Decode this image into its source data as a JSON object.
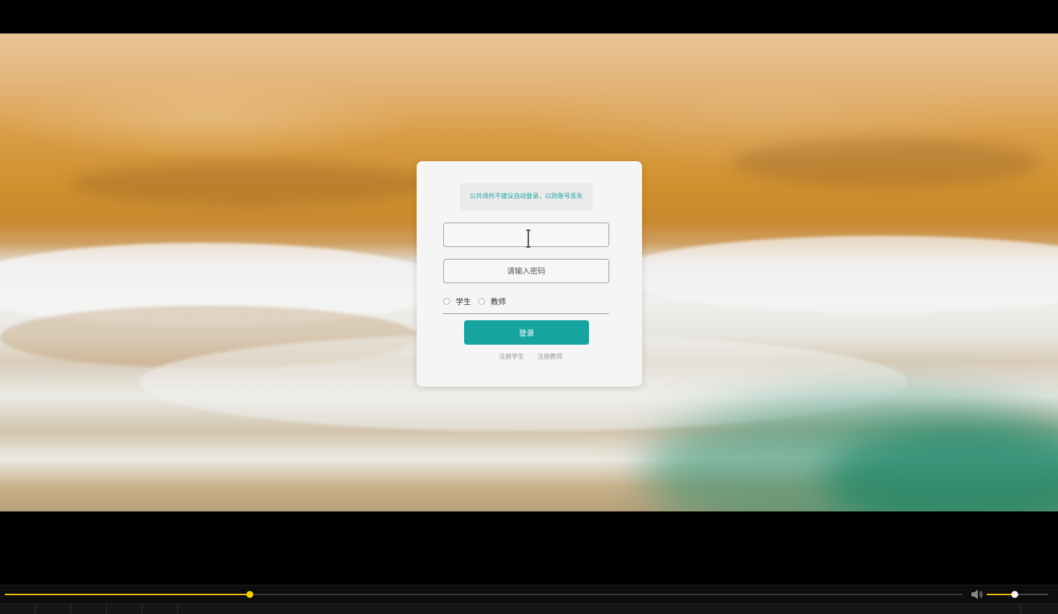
{
  "login": {
    "notice": "公共场所不建议自动登录，以防账号丢失",
    "username_value": "",
    "password_placeholder": "请输入密码",
    "roles": [
      "学生",
      "教师"
    ],
    "login_button": "登录",
    "register_student": "注册学生",
    "register_teacher": "注册教师"
  },
  "player": {
    "progress": 0.256,
    "volume": 0.45,
    "accent_color": "#f2c400",
    "volume_icon": "speaker-icon"
  },
  "colors": {
    "teal": "#17a4a0",
    "card": "#f5f5f5"
  }
}
